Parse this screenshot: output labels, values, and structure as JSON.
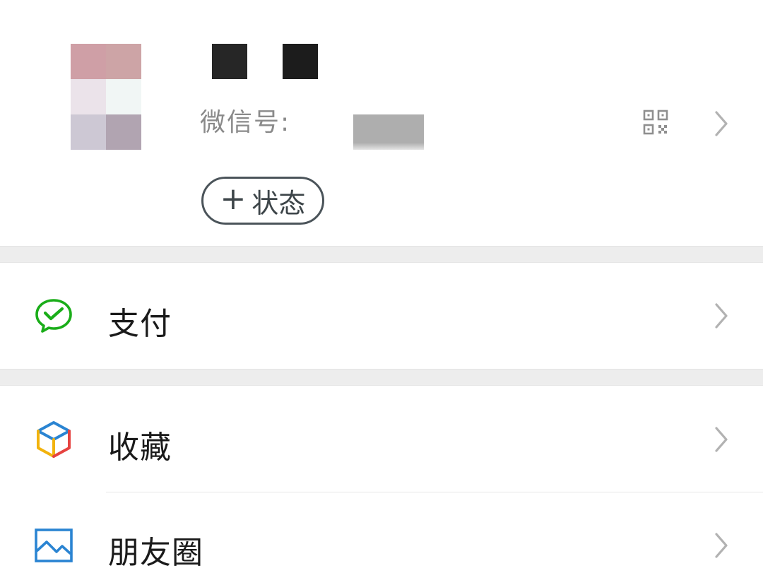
{
  "profile": {
    "wechat_id_label": "微信号:",
    "status_button_plus": "+",
    "status_button_label": "状态"
  },
  "menu": {
    "items": [
      {
        "label": "支付",
        "icon": "wechat-pay-icon"
      },
      {
        "label": "收藏",
        "icon": "favorites-cube-icon"
      },
      {
        "label": "朋友圈",
        "icon": "moments-image-icon"
      }
    ]
  },
  "colors": {
    "pay_green": "#1aad19",
    "moments_blue": "#2a84d2",
    "chevron_gray": "#b2b2b2",
    "section_gap": "#ededed"
  }
}
